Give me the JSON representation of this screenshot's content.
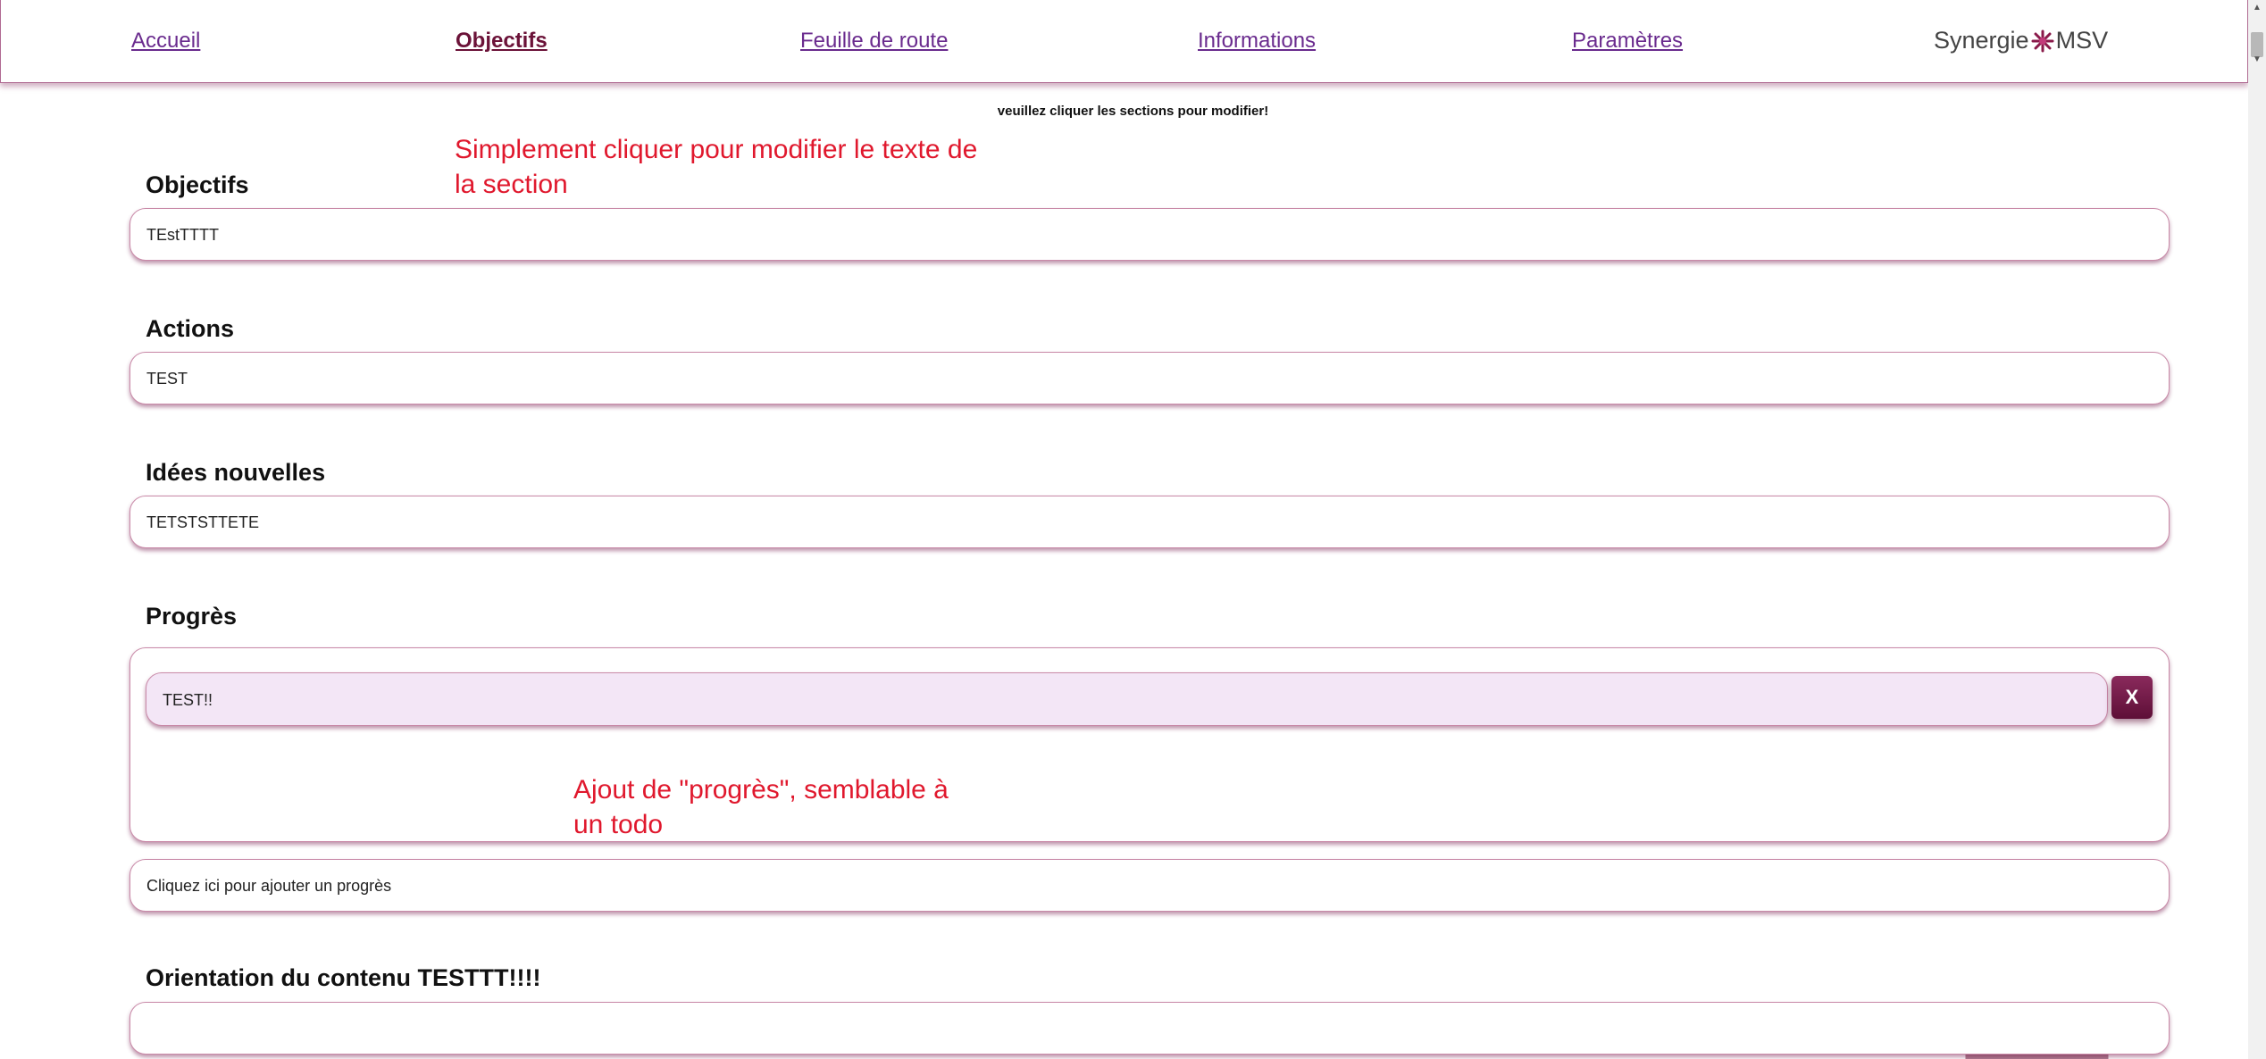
{
  "nav": {
    "links": [
      {
        "label": "Accueil"
      },
      {
        "label": "Objectifs"
      },
      {
        "label": "Feuille de route"
      },
      {
        "label": "Informations"
      },
      {
        "label": "Paramètres"
      }
    ],
    "active": "Objectifs",
    "brand": {
      "left": "Synergie",
      "right": "MSV"
    }
  },
  "hint": "veuillez cliquer les sections pour modifier!",
  "annotations": {
    "edit_line1": "Simplement cliquer pour modifier le texte de",
    "edit_line2": "la section",
    "progress_line1": "Ajout de \"progrès\", semblable à",
    "progress_line2": "un todo"
  },
  "sections": {
    "objectifs": {
      "title": "Objectifs",
      "value": "TEstTTTT"
    },
    "actions": {
      "title": "Actions",
      "value": "TEST"
    },
    "idees": {
      "title": "Idées nouvelles",
      "value": "TETSTSTTETE"
    },
    "progres": {
      "title": "Progrès",
      "items": [
        {
          "text": "TEST!!",
          "delete_label": "X"
        }
      ],
      "add_placeholder": "Cliquez ici pour ajouter un progrès"
    },
    "orientation": {
      "title": "Orientation du contenu TESTTT!!!!",
      "value": ""
    }
  },
  "colors": {
    "accent": "#6b1238",
    "link": "#6a2b8e",
    "annotation": "#e0182d",
    "progress_item_bg": "#f3e6f6"
  },
  "icons": {
    "brand_mark": "synergie-star-icon",
    "scroll_up": "triangle-up-icon",
    "scroll_down": "triangle-down-icon"
  }
}
